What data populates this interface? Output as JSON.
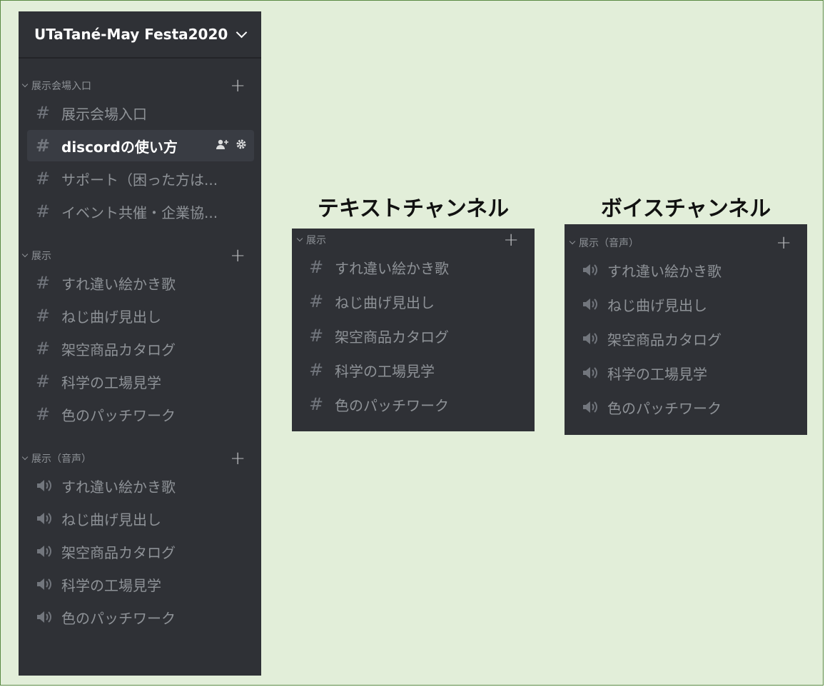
{
  "server": {
    "name": "UTaTané-May Festa2020"
  },
  "sidebar": {
    "categories": [
      {
        "label": "展示会場入口",
        "channels": [
          {
            "name": "展示会場入口",
            "type": "text"
          },
          {
            "name": "discordの使い方",
            "type": "text",
            "active": true
          },
          {
            "name": "サポート（困った方は...",
            "type": "text"
          },
          {
            "name": "イベント共催・企業協...",
            "type": "text"
          }
        ]
      },
      {
        "label": "展示",
        "channels": [
          {
            "name": "すれ違い絵かき歌",
            "type": "text"
          },
          {
            "name": "ねじ曲げ見出し",
            "type": "text"
          },
          {
            "name": "架空商品カタログ",
            "type": "text"
          },
          {
            "name": "科学の工場見学",
            "type": "text"
          },
          {
            "name": "色のパッチワーク",
            "type": "text"
          }
        ]
      },
      {
        "label": "展示（音声）",
        "channels": [
          {
            "name": "すれ違い絵かき歌",
            "type": "voice"
          },
          {
            "name": "ねじ曲げ見出し",
            "type": "voice"
          },
          {
            "name": "架空商品カタログ",
            "type": "voice"
          },
          {
            "name": "科学の工場見学",
            "type": "voice"
          },
          {
            "name": "色のパッチワーク",
            "type": "voice"
          }
        ]
      }
    ]
  },
  "text_panel": {
    "heading": "テキストチャンネル",
    "category": "展示",
    "channels": [
      "すれ違い絵かき歌",
      "ねじ曲げ見出し",
      "架空商品カタログ",
      "科学の工場見学",
      "色のパッチワーク"
    ]
  },
  "voice_panel": {
    "heading": "ボイスチャンネル",
    "category": "展示（音声）",
    "channels": [
      "すれ違い絵かき歌",
      "ねじ曲げ見出し",
      "架空商品カタログ",
      "科学の工場見学",
      "色のパッチワーク"
    ]
  },
  "colors": {
    "sidebar_bg": "#2f3136",
    "page_bg": "#e2eed9",
    "border": "#5a8a43"
  }
}
